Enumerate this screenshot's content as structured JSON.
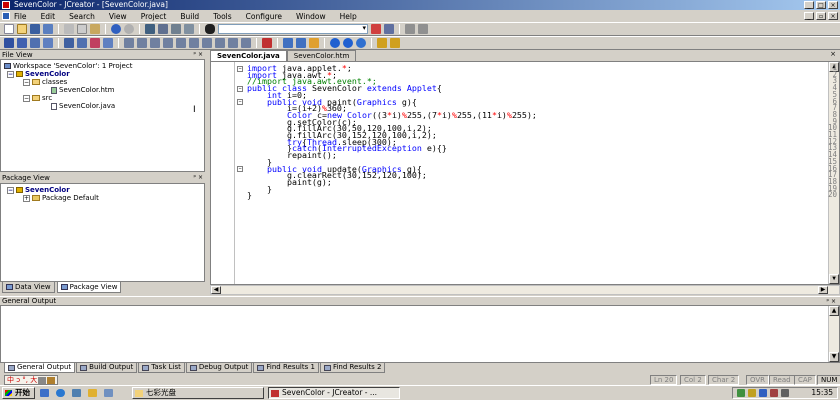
{
  "window": {
    "title": "SevenColor - JCreator - [SevenColor.java]",
    "controls": [
      "_",
      "□",
      "×"
    ],
    "mdi_controls": [
      "_",
      "▫",
      "×"
    ]
  },
  "menu": [
    "File",
    "Edit",
    "Search",
    "View",
    "Project",
    "Build",
    "Tools",
    "Configure",
    "Window",
    "Help"
  ],
  "file_view": {
    "title": "File View",
    "header_buttons": "ᵖ ×",
    "workspace": "Workspace 'SevenColor': 1 Project",
    "project": "SevenColor",
    "folders": [
      {
        "name": "classes",
        "files": [
          "SevenColor.htm"
        ]
      },
      {
        "name": "src",
        "files": [
          "SevenColor.java"
        ]
      }
    ]
  },
  "package_view": {
    "title": "Package View",
    "header_buttons": "ᵖ ×",
    "project": "SevenColor",
    "child": "Package Default"
  },
  "left_tabs": [
    "Data View",
    "Package View"
  ],
  "editor": {
    "tabs": [
      "SevenColor.java",
      "SevenColor.htm"
    ],
    "close": "×",
    "lines": [
      "import java.applet.*;",
      "import java.awt.*;",
      "//import java.awt.event.*;",
      "public class SevenColor extends Applet{",
      "    int i=0;",
      "    public void paint(Graphics g){",
      "        i=(i+2)%360;",
      "        Color c=new Color((3*i)%255,(7*i)%255,(11*i)%255);",
      "        g.setColor(c);",
      "        g.fillArc(30,50,120,100,i,2);",
      "        g.fillArc(30,152,120,100,i,2);",
      "        try{Thread.sleep(300);",
      "        }catch(InterruptedException e){}",
      "        repaint();",
      "    }",
      "    public void update(Graphics g){",
      "        g.clearRect(30,152,120,100);",
      "        paint(g);",
      "    }",
      "}"
    ]
  },
  "output": {
    "title": "General Output",
    "header_buttons": "ᵖ ×",
    "tabs": [
      "General Output",
      "Build Output",
      "Task List",
      "Debug Output",
      "Find Results 1",
      "Find Results 2"
    ]
  },
  "status": {
    "ime": "中 ᴐ °, 大",
    "ln": "Ln 20",
    "col": "Col 2",
    "char": "Char 2",
    "ovr": "OVR",
    "read": "Read",
    "cap": "CAP",
    "num": "NUM"
  },
  "taskbar": {
    "start": "开始",
    "items": [
      "七彩光盘",
      "SevenColor - JCreator - ..."
    ],
    "clock": "15:35"
  },
  "colors": {
    "keyword": "#0000ff",
    "comment": "#008000",
    "number": "#ff0000",
    "titlebar": "#0a246a"
  }
}
